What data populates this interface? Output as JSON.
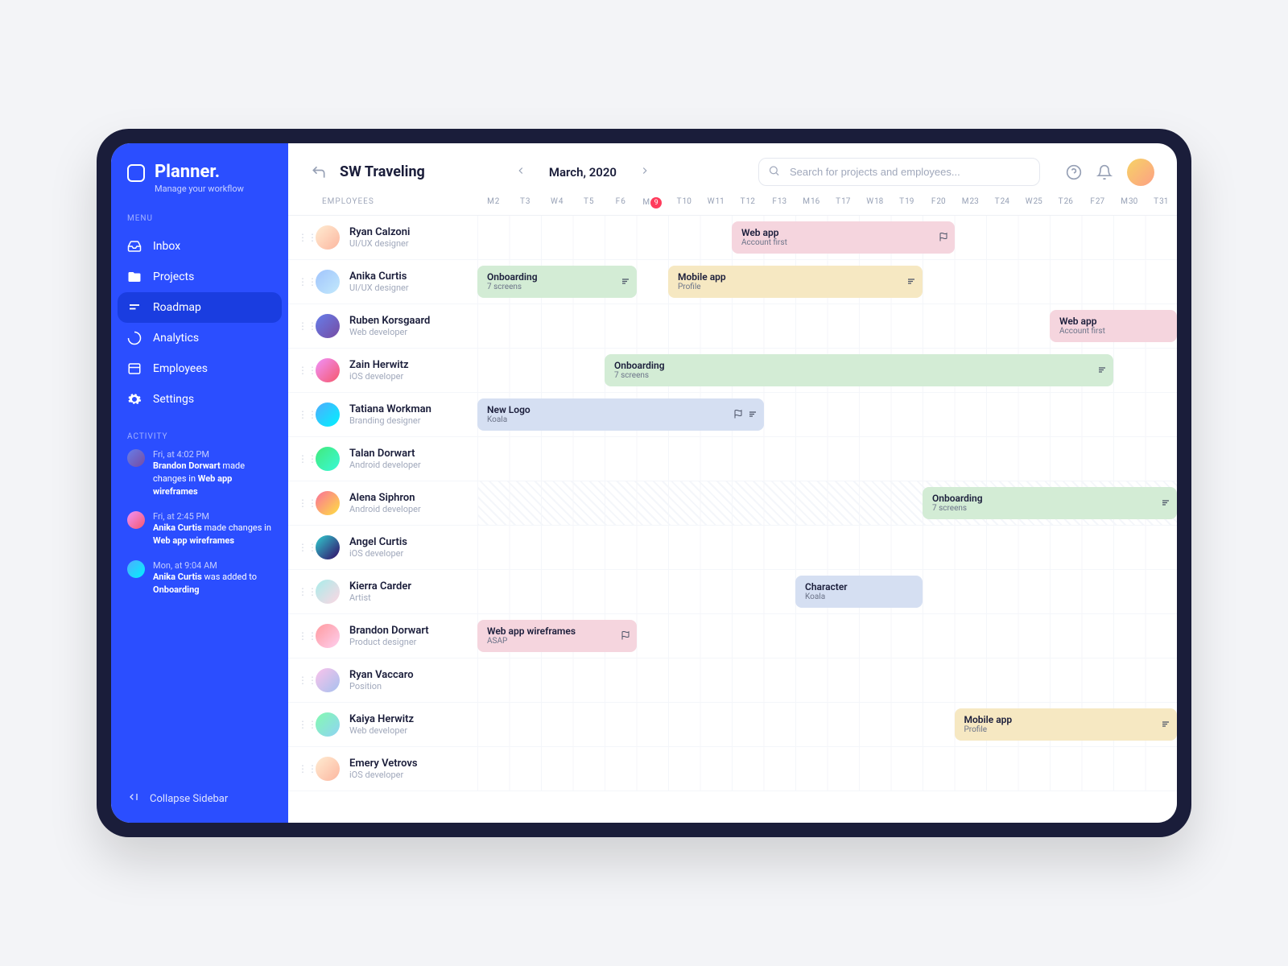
{
  "app": {
    "name": "Planner.",
    "tagline": "Manage your workflow"
  },
  "sidebar": {
    "menu_label": "MENU",
    "items": [
      {
        "label": "Inbox"
      },
      {
        "label": "Projects"
      },
      {
        "label": "Roadmap"
      },
      {
        "label": "Analytics"
      },
      {
        "label": "Employees"
      },
      {
        "label": "Settings"
      }
    ],
    "activity_label": "ACTIVITY",
    "activity": [
      {
        "time": "Fri, at 4:02 PM",
        "actor": "Brandon Dorwart",
        "mid": " made changes ",
        "prep": "in ",
        "target": "Web app wireframes"
      },
      {
        "time": "Fri, at 2:45 PM",
        "actor": "Anika Curtis",
        "mid": " made changes ",
        "prep": "in ",
        "target": "Web app wireframes"
      },
      {
        "time": "Mon, at 9:04 AM",
        "actor": "Anika Curtis",
        "mid": " was added to ",
        "prep": "",
        "target": "Onboarding"
      }
    ],
    "collapse_label": "Collapse Sidebar"
  },
  "header": {
    "project": "SW Traveling",
    "month": "March, 2020",
    "search_placeholder": "Search for projects and employees..."
  },
  "timeline": {
    "employees_header": "EMPLOYEES",
    "today_index": 5,
    "days": [
      {
        "dow": "M",
        "num": "2"
      },
      {
        "dow": "T",
        "num": "3"
      },
      {
        "dow": "W",
        "num": "4"
      },
      {
        "dow": "T",
        "num": "5"
      },
      {
        "dow": "F",
        "num": "6"
      },
      {
        "dow": "M",
        "num": "9"
      },
      {
        "dow": "T",
        "num": "10"
      },
      {
        "dow": "W",
        "num": "11"
      },
      {
        "dow": "T",
        "num": "12"
      },
      {
        "dow": "F",
        "num": "13"
      },
      {
        "dow": "M",
        "num": "16"
      },
      {
        "dow": "T",
        "num": "17"
      },
      {
        "dow": "W",
        "num": "18"
      },
      {
        "dow": "T",
        "num": "19"
      },
      {
        "dow": "F",
        "num": "20"
      },
      {
        "dow": "M",
        "num": "23"
      },
      {
        "dow": "T",
        "num": "24"
      },
      {
        "dow": "W",
        "num": "25"
      },
      {
        "dow": "T",
        "num": "26"
      },
      {
        "dow": "F",
        "num": "27"
      },
      {
        "dow": "M",
        "num": "30"
      },
      {
        "dow": "T",
        "num": "31"
      }
    ],
    "rows": [
      {
        "name": "Ryan Calzoni",
        "role": "UI/UX designer",
        "avatar": "av1",
        "tasks": [
          {
            "title": "Web app",
            "sub": "Account first",
            "color": "pink",
            "start": 8,
            "span": 7,
            "icons": [
              "flag"
            ]
          }
        ]
      },
      {
        "name": "Anika Curtis",
        "role": "UI/UX designer",
        "avatar": "av2",
        "tasks": [
          {
            "title": "Onboarding",
            "sub": "7 screens",
            "color": "green",
            "start": 0,
            "span": 5,
            "icons": [
              "notes"
            ]
          },
          {
            "title": "Mobile app",
            "sub": "Profile",
            "color": "yellow",
            "start": 6,
            "span": 8,
            "icons": [
              "notes"
            ]
          }
        ]
      },
      {
        "name": "Ruben Korsgaard",
        "role": "Web developer",
        "avatar": "av3",
        "tasks": [
          {
            "title": "Web app",
            "sub": "Account first",
            "color": "pink",
            "start": 18,
            "span": 4,
            "icons": []
          }
        ]
      },
      {
        "name": "Zain Herwitz",
        "role": "iOS developer",
        "avatar": "av4",
        "tasks": [
          {
            "title": "Onboarding",
            "sub": "7 screens",
            "color": "green",
            "start": 4,
            "span": 16,
            "icons": [
              "notes"
            ]
          }
        ]
      },
      {
        "name": "Tatiana Workman",
        "role": "Branding designer",
        "avatar": "av5",
        "tasks": [
          {
            "title": "New Logo",
            "sub": "Koala",
            "color": "blue",
            "start": 0,
            "span": 9,
            "icons": [
              "flag",
              "notes"
            ]
          }
        ]
      },
      {
        "name": "Talan Dorwart",
        "role": "Android developer",
        "avatar": "av6",
        "tasks": []
      },
      {
        "name": "Alena Siphron",
        "role": "Android developer",
        "avatar": "av7",
        "hatched": true,
        "tasks": [
          {
            "title": "Onboarding",
            "sub": "7 screens",
            "color": "green",
            "start": 14,
            "span": 8,
            "icons": [
              "notes"
            ]
          }
        ]
      },
      {
        "name": "Angel Curtis",
        "role": "iOS developer",
        "avatar": "av8",
        "tasks": []
      },
      {
        "name": "Kierra Carder",
        "role": "Artist",
        "avatar": "av9",
        "tasks": [
          {
            "title": "Character",
            "sub": "Koala",
            "color": "blue",
            "start": 10,
            "span": 4,
            "icons": []
          }
        ]
      },
      {
        "name": "Brandon Dorwart",
        "role": "Product designer",
        "avatar": "av10",
        "tasks": [
          {
            "title": "Web app wireframes",
            "sub": "ASAP",
            "color": "pink",
            "start": 0,
            "span": 5,
            "icons": [
              "flag"
            ]
          }
        ]
      },
      {
        "name": "Ryan Vaccaro",
        "role": "Position",
        "avatar": "av11",
        "tasks": []
      },
      {
        "name": "Kaiya Herwitz",
        "role": "Web developer",
        "avatar": "av12",
        "tasks": [
          {
            "title": "Mobile app",
            "sub": "Profile",
            "color": "yellow",
            "start": 15,
            "span": 7,
            "icons": [
              "notes"
            ]
          }
        ]
      },
      {
        "name": "Emery Vetrovs",
        "role": "iOS developer",
        "avatar": "av1",
        "tasks": []
      }
    ]
  }
}
